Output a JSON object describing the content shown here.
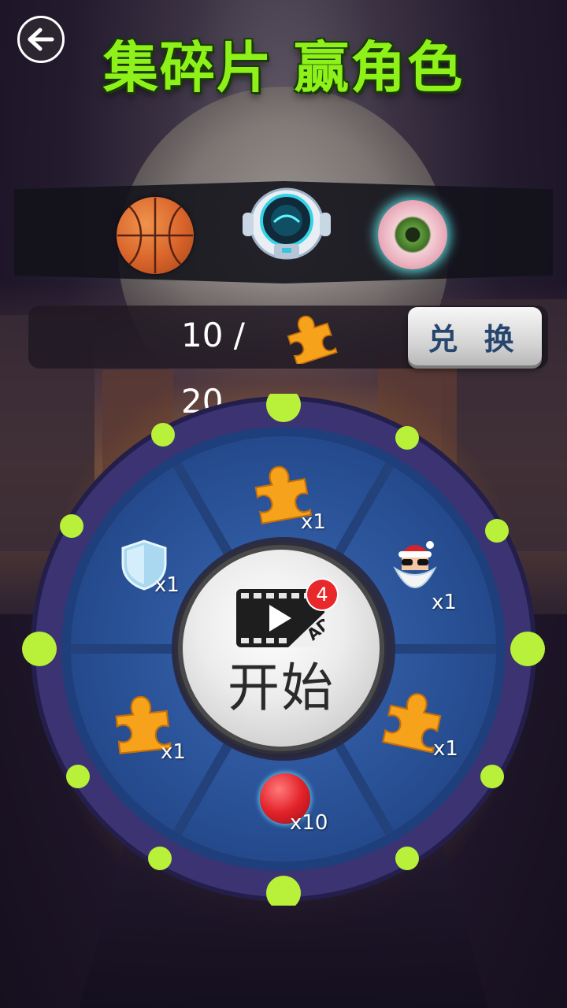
{
  "header": {
    "title": "集碎片  赢角色",
    "back_icon": "arrow-left-icon"
  },
  "characters": [
    {
      "name": "basketball",
      "icon": "basketball-icon"
    },
    {
      "name": "robot",
      "icon": "robot-icon"
    },
    {
      "name": "eyeball",
      "icon": "eyeball-icon"
    }
  ],
  "progress": {
    "current": "10 /",
    "total": "20",
    "icon": "puzzle-piece-icon",
    "fraction": 0.5
  },
  "exchange_button": {
    "label": "兑 换"
  },
  "wheel": {
    "rewards": [
      {
        "item": "puzzle-piece-icon",
        "quantity": "x1"
      },
      {
        "item": "santa-icon",
        "quantity": "x1"
      },
      {
        "item": "puzzle-piece-icon",
        "quantity": "x1"
      },
      {
        "item": "red-ball-icon",
        "quantity": "x10"
      },
      {
        "item": "puzzle-piece-icon",
        "quantity": "x1"
      },
      {
        "item": "shield-icon",
        "quantity": "x1"
      }
    ],
    "start_button": {
      "label": "开始",
      "ad_icon": "video-ad-icon",
      "badge_count": "4"
    }
  },
  "colors": {
    "title_green": "#8ef21a",
    "wheel_blue": "#2e5aa3",
    "wheel_rim": "#3b3a7a",
    "light_dot": "#b8f03a",
    "badge_red": "#e8282a",
    "exchange_text": "#27466e"
  }
}
